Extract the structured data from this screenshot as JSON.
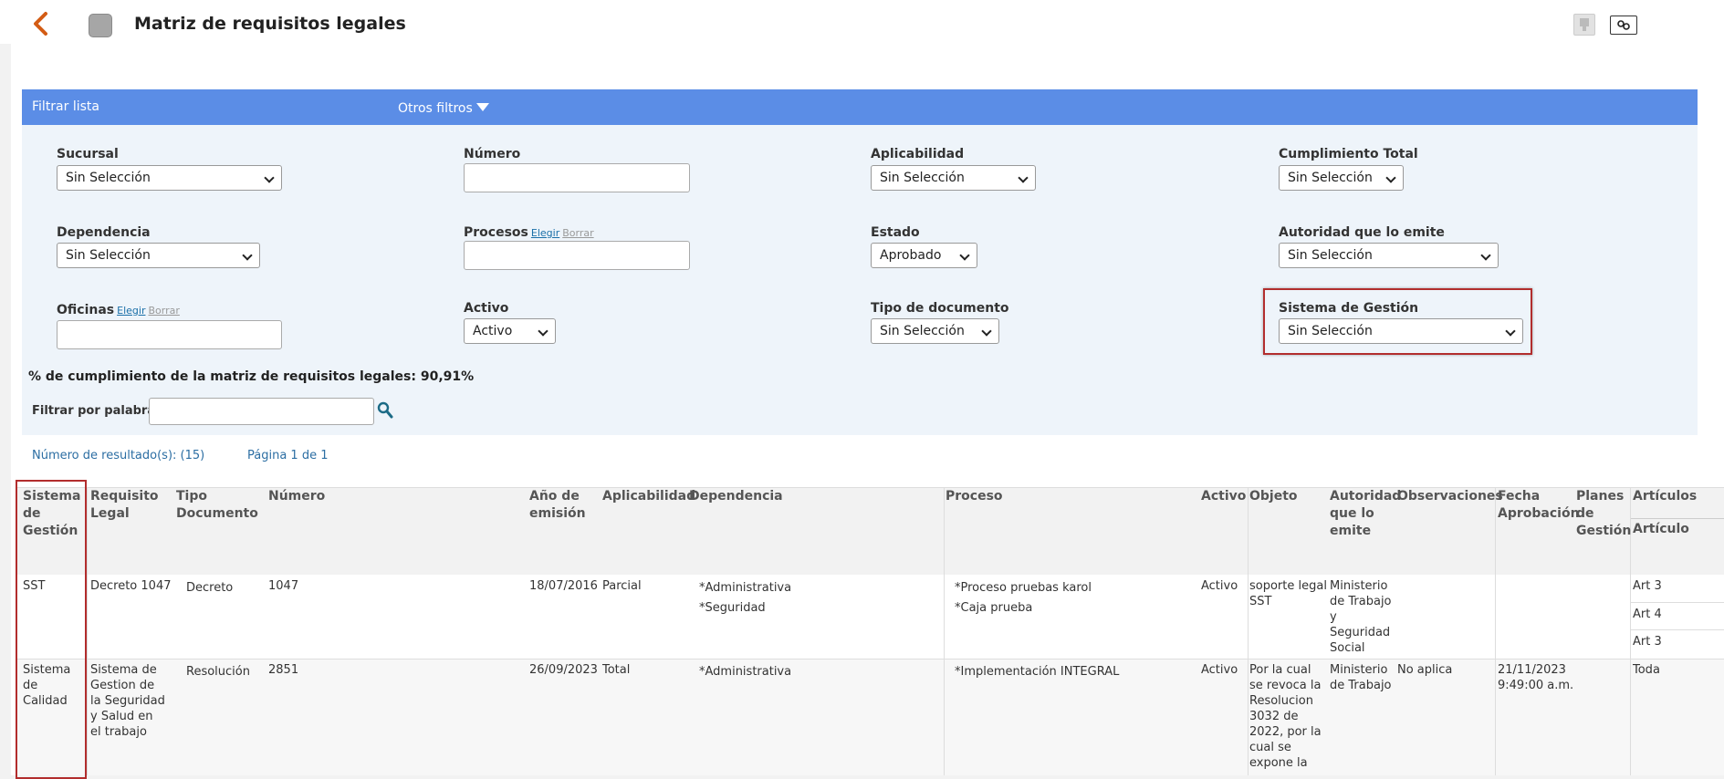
{
  "header": {
    "title": "Matriz de requisitos legales"
  },
  "filter": {
    "title": "Filtrar lista",
    "other_filters": "Otros filtros",
    "sucursal": {
      "label": "Sucursal",
      "value": "Sin Selección"
    },
    "numero": {
      "label": "Número",
      "value": ""
    },
    "aplicabilidad": {
      "label": "Aplicabilidad",
      "value": "Sin Selección"
    },
    "cumplimiento": {
      "label": "Cumplimiento Total",
      "value": "Sin Selección"
    },
    "dependencia": {
      "label": "Dependencia",
      "value": "Sin Selección"
    },
    "procesos": {
      "label": "Procesos",
      "choose": "Elegir",
      "clear": "Borrar"
    },
    "estado": {
      "label": "Estado",
      "value": "Aprobado"
    },
    "autoridad": {
      "label": "Autoridad que lo emite",
      "value": "Sin Selección"
    },
    "oficinas": {
      "label": "Oficinas",
      "choose": "Elegir",
      "clear": "Borrar"
    },
    "activo": {
      "label": "Activo",
      "value": "Activo"
    },
    "tipo_documento": {
      "label": "Tipo de documento",
      "value": "Sin Selección"
    },
    "sistema_gestion": {
      "label": "Sistema de Gestión",
      "value": "Sin Selección"
    },
    "compliance_text": "% de cumplimiento de la matriz de requisitos legales: 90,91%",
    "word_filter_label": "Filtrar por palabra",
    "word_filter_value": ""
  },
  "results": {
    "count_label": "Número de resultado(s): ",
    "count": "(15)",
    "page": "Página 1 de 1"
  },
  "table": {
    "headers": {
      "sistema": "Sistema de Gestión",
      "requisito": "Requisito Legal",
      "tipo": "Tipo Documento",
      "numero": "Número",
      "anio": "Año de emisión",
      "aplicabilidad": "Aplicabilidad",
      "dependencia": "Dependencia",
      "proceso": "Proceso",
      "activo": "Activo",
      "objeto": "Objeto",
      "autoridad": "Autoridad que lo emite",
      "observaciones": "Observaciones",
      "fecha": "Fecha Aprobación",
      "planes": "Planes de Gestión",
      "articulos": "Artículos",
      "articulo": "Artículo"
    },
    "rows": [
      {
        "sistema": "SST",
        "requisito": "Decreto 1047",
        "tipo": "Decreto",
        "numero": "1047",
        "anio": "18/07/2016",
        "aplicabilidad": "Parcial",
        "dependencia": [
          "*Administrativa",
          "*Seguridad"
        ],
        "proceso": [
          "*Proceso pruebas karol",
          "*Caja prueba"
        ],
        "activo": "Activo",
        "objeto": "soporte legal SST",
        "autoridad": "Ministerio de Trabajo y Seguridad Social",
        "observaciones": "",
        "fecha": "",
        "planes": "",
        "articulos": [
          "Art 3",
          "Art 4",
          "Art 3"
        ]
      },
      {
        "sistema": "Sistema de Calidad",
        "requisito": "Sistema de Gestion de la Seguridad y Salud en el trabajo",
        "tipo": "Resolución",
        "numero": "2851",
        "anio": "26/09/2023",
        "aplicabilidad": "Total",
        "dependencia": [
          "*Administrativa"
        ],
        "proceso": [
          "*Implementación INTEGRAL"
        ],
        "activo": "Activo",
        "objeto": "Por la cual se revoca la Resolucion 3032 de 2022, por la cual se expone la",
        "autoridad": "Ministerio de Trabajo",
        "observaciones": "No aplica",
        "fecha": "21/11/2023 9:49:00 a.m.",
        "planes": "",
        "articulos": [
          "Toda"
        ]
      }
    ]
  },
  "colors": {
    "accent": "#5b8de6",
    "back_arrow": "#d35c14",
    "highlight": "#b22d2d"
  }
}
